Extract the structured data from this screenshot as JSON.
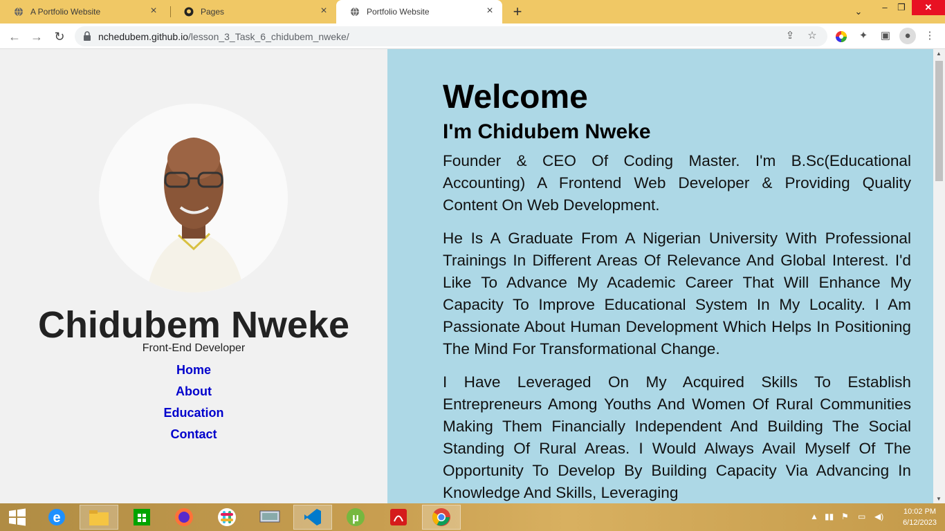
{
  "browser": {
    "tabs": [
      {
        "title": "A Portfolio Website",
        "icon": "globe-icon"
      },
      {
        "title": "Pages",
        "icon": "github-icon"
      },
      {
        "title": "Portfolio Website",
        "icon": "globe-icon"
      }
    ],
    "url_host": "nchedubem.github.io",
    "url_path": "/lesson_3_Task_6_chidubem_nweke/"
  },
  "sidebar": {
    "name": "Chidubem Nweke",
    "role": "Front-End Developer",
    "nav": [
      "Home",
      "About",
      "Education",
      "Contact"
    ]
  },
  "main": {
    "heading": "Welcome",
    "subheading": "I'm Chidubem Nweke",
    "paragraphs": [
      "Founder & CEO Of Coding Master. I'm B.Sc(Educational Accounting) A Frontend Web Developer & Providing Quality Content On Web Development.",
      "He Is A Graduate From A Nigerian University With Professional Trainings In Different Areas Of Relevance And Global Interest. I'd Like To Advance My Academic Career That Will Enhance My Capacity To Improve Educational System In My Locality. I Am Passionate About Human Development Which Helps In Positioning The Mind For Transformational Change.",
      "I Have Leveraged On My Acquired Skills To Establish Entrepreneurs Among Youths And Women Of Rural Communities Making Them Financially Independent And Building The Social Standing Of Rural Areas. I Would Always Avail Myself Of The Opportunity To Develop By Building Capacity Via Advancing In Knowledge And Skills, Leveraging"
    ]
  },
  "taskbar": {
    "time": "10:02 PM",
    "date": "6/12/2023",
    "apps": [
      "ie-icon",
      "file-explorer-icon",
      "store-icon",
      "firefox-icon",
      "slack-icon",
      "keyboard-icon",
      "vscode-icon",
      "utorrent-icon",
      "acrobat-icon",
      "chrome-icon"
    ]
  },
  "colors": {
    "tab_strip": "#f0c865",
    "left_panel": "#f1f1f1",
    "right_panel": "#add8e6",
    "nav_link": "#0000cc"
  }
}
